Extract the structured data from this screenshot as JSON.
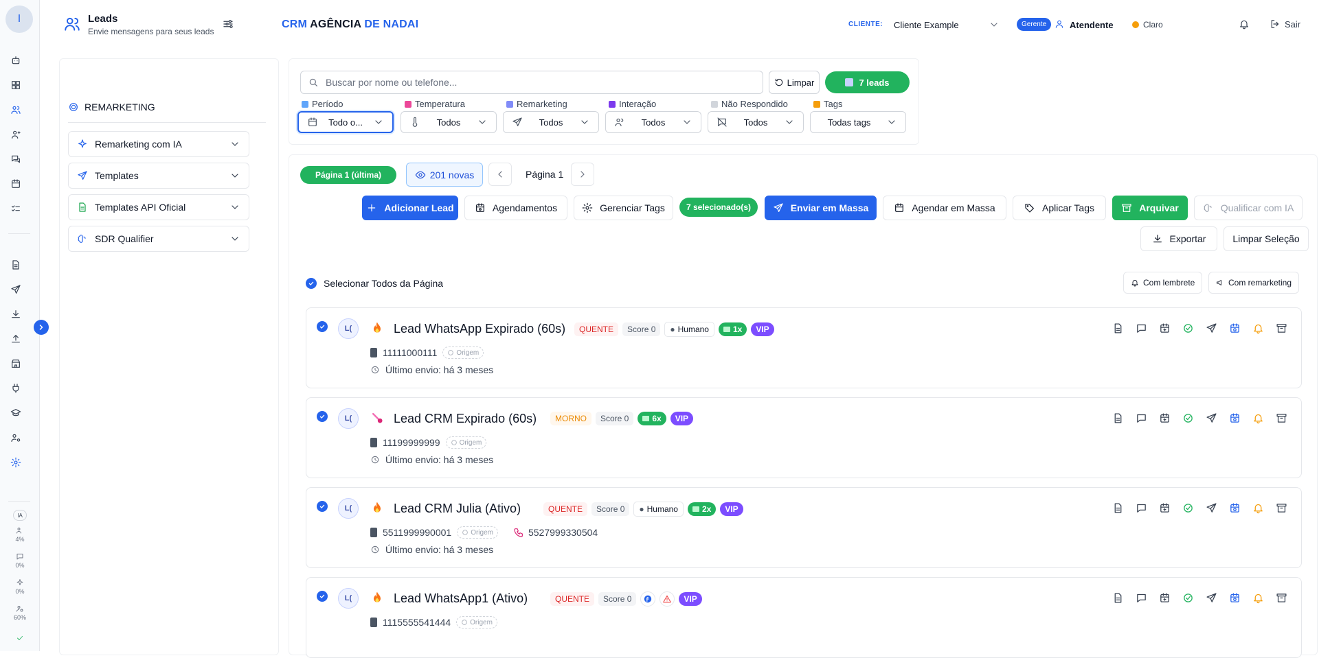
{
  "rail": {
    "avatar_letter": "I",
    "ia_label": "IA",
    "stats": [
      "4%",
      "0%",
      "0%",
      "60%"
    ]
  },
  "header": {
    "title": "Leads",
    "subtitle": "Envie mensagens para seus leads",
    "brand_1": "CRM",
    "brand_2": "AGÊNCIA",
    "brand_3": "DE NADAI",
    "client_label": "CLIENTE:",
    "client_value": "Cliente Example",
    "role_badge": "Gerente",
    "user_name": "Atendente",
    "theme_label": "Claro",
    "logout_label": "Sair"
  },
  "remarketing": {
    "title": "REMARKETING",
    "items": [
      {
        "label": "Remarketing com IA"
      },
      {
        "label": "Templates"
      },
      {
        "label": "Templates API Oficial"
      },
      {
        "label": "SDR Qualifier"
      }
    ]
  },
  "filters": {
    "search_placeholder": "Buscar por nome ou telefone...",
    "clear_label": "Limpar",
    "leads_count_label": "7 leads",
    "groups": [
      {
        "label": "Período",
        "value": "Todo o..."
      },
      {
        "label": "Temperatura",
        "value": "Todos"
      },
      {
        "label": "Remarketing",
        "value": "Todos"
      },
      {
        "label": "Interação",
        "value": "Todos"
      },
      {
        "label": "Não Respondido",
        "value": "Todos"
      },
      {
        "label": "Tags",
        "value": "Todas tags"
      }
    ]
  },
  "pagination": {
    "badge": "Página 1 (última)",
    "new_label": "201 novas",
    "page_label": "Página 1"
  },
  "actions": {
    "add_lead": "Adicionar Lead",
    "agendamentos": "Agendamentos",
    "gerenciar_tags": "Gerenciar Tags",
    "selected_count": "7 selecionado(s)",
    "enviar_massa": "Enviar em Massa",
    "agendar_massa": "Agendar em Massa",
    "aplicar_tags": "Aplicar Tags",
    "arquivar": "Arquivar",
    "qualificar_ia": "Qualificar com IA",
    "exportar": "Exportar",
    "limpar_selecao": "Limpar Seleção"
  },
  "list": {
    "select_all_label": "Selecionar Todos da Página",
    "filter_lembrete": "Com lembrete",
    "filter_remarketing": "Com remarketing",
    "origem_label": "Origem",
    "leads": [
      {
        "initials": "L(",
        "name": "Lead WhatsApp Expirado (60s)",
        "temperature": "QUENTE",
        "score": "Score 0",
        "humano": "Humano",
        "count": "1x",
        "vip": "VIP",
        "phone": "11111000111",
        "phone2": "",
        "last_send": "Último envio: há 3 meses"
      },
      {
        "initials": "L(",
        "name": "Lead CRM Expirado (60s)",
        "temperature": "MORNO",
        "score": "Score 0",
        "humano": "",
        "count": "6x",
        "vip": "VIP",
        "phone": "11199999999",
        "phone2": "",
        "last_send": "Último envio: há 3 meses"
      },
      {
        "initials": "L(",
        "name": "Lead CRM Julia (Ativo)",
        "temperature": "QUENTE",
        "score": "Score 0",
        "humano": "Humano",
        "count": "2x",
        "vip": "VIP",
        "phone": "5511999990001",
        "phone2": "5527999330504",
        "last_send": "Último envio: há 3 meses"
      },
      {
        "initials": "L(",
        "name": "Lead WhatsApp1 (Ativo)",
        "temperature": "QUENTE",
        "score": "Score 0",
        "humano": "",
        "count": "",
        "vip": "VIP",
        "phone": "1115555541444",
        "phone2": "",
        "last_send": ""
      }
    ]
  },
  "colors": {
    "accent": "#2563eb",
    "success": "#22b35e",
    "vip": "#7c4dff",
    "hot": "#dc2626",
    "warm": "#ea8a04"
  }
}
